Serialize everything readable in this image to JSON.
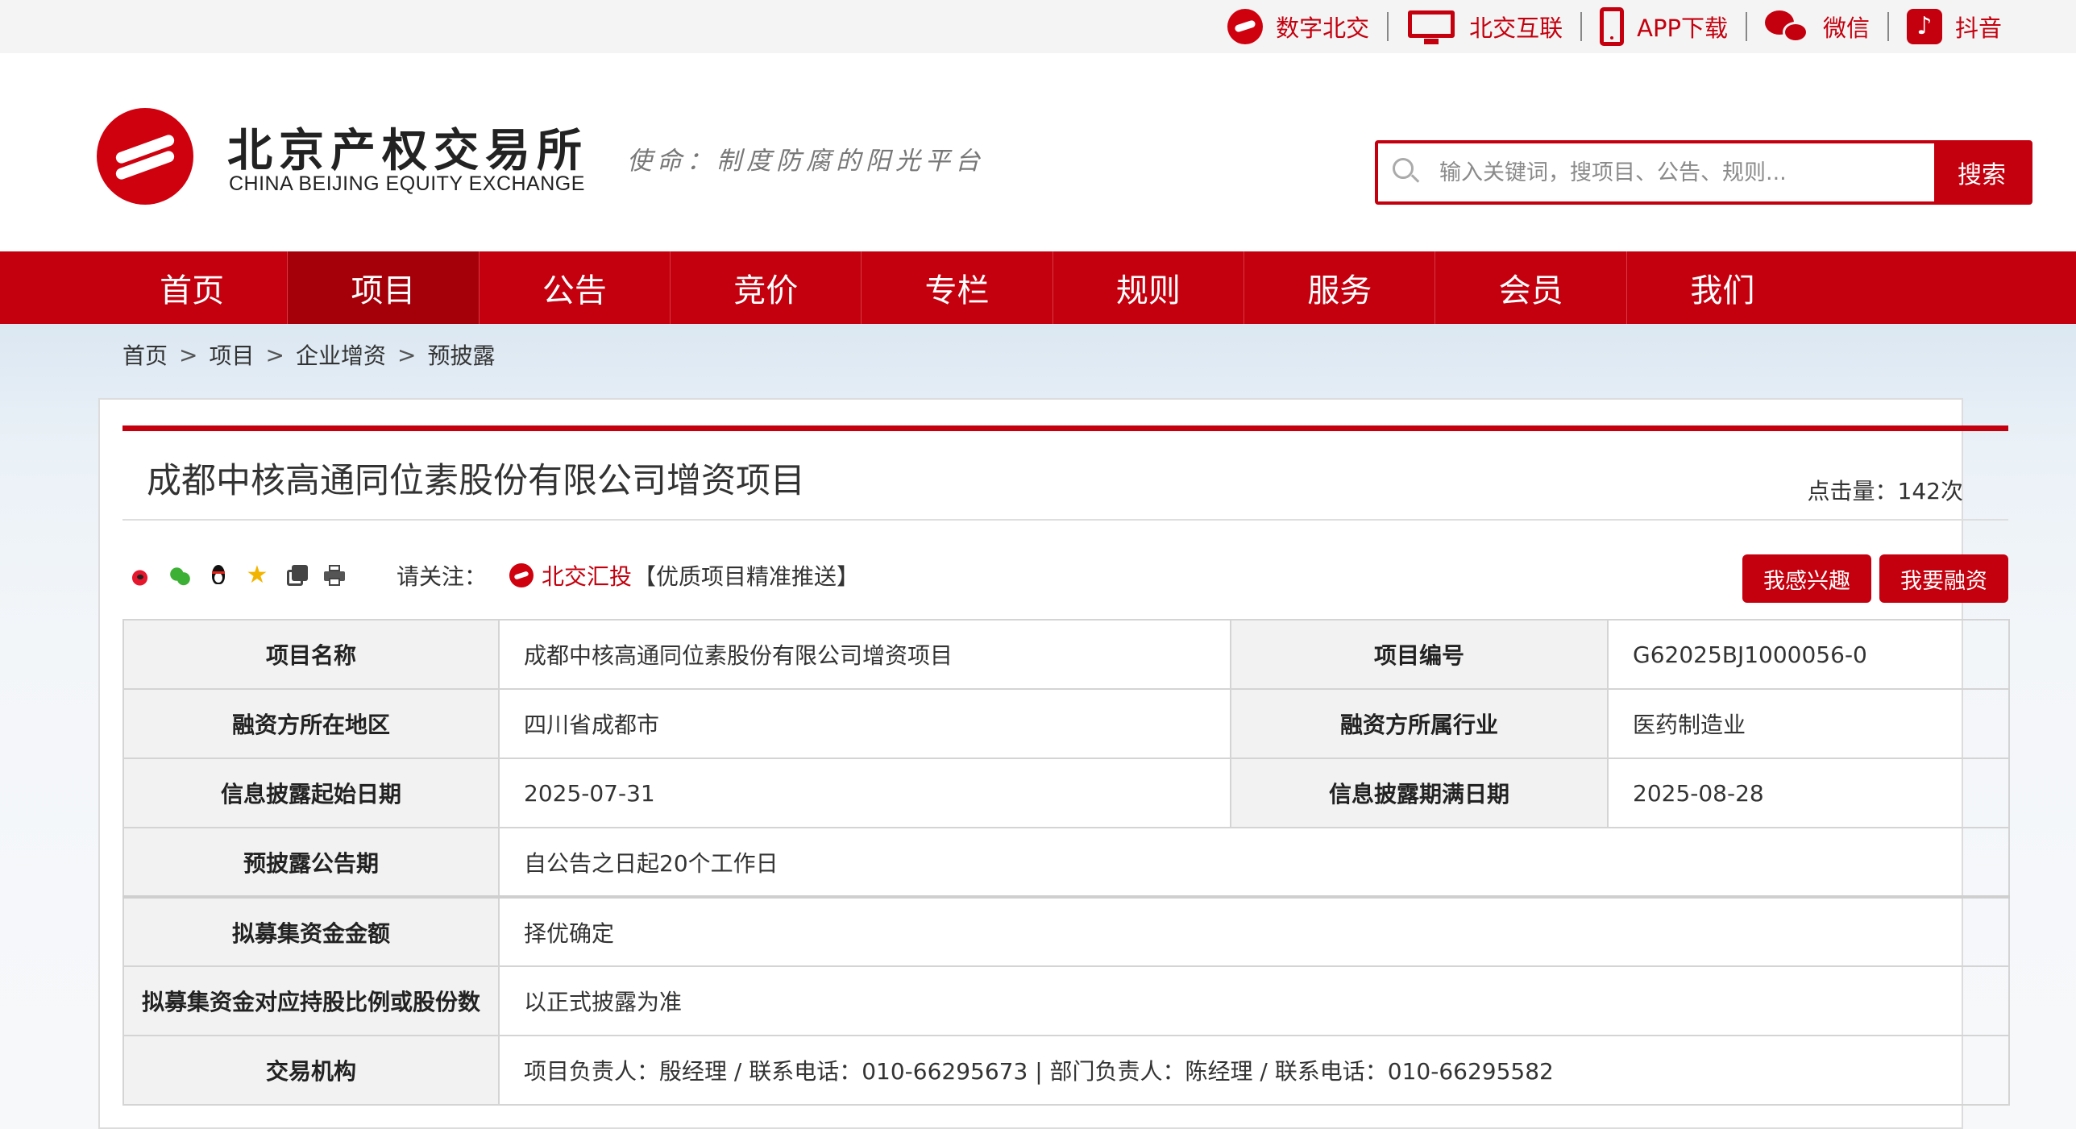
{
  "topbar": {
    "links": [
      {
        "label": "数字北交",
        "icon": "cbex-logo-icon"
      },
      {
        "label": "北交互联",
        "icon": "monitor-icon"
      },
      {
        "label": "APP下载",
        "icon": "mobile-phone-icon"
      },
      {
        "label": "微信",
        "icon": "wechat-icon"
      },
      {
        "label": "抖音",
        "icon": "douyin-icon"
      }
    ]
  },
  "header": {
    "logo_cn": "北京产权交易所",
    "logo_en": "CHINA BEIJING EQUITY EXCHANGE",
    "slogan": "使命：制度防腐的阳光平台",
    "search": {
      "placeholder": "输入关键词，搜项目、公告、规则...",
      "button_label": "搜索"
    }
  },
  "nav": {
    "items": [
      "首页",
      "项目",
      "公告",
      "竞价",
      "专栏",
      "规则",
      "服务",
      "会员",
      "我们"
    ],
    "active": "项目"
  },
  "breadcrumb": [
    "首页",
    "项目",
    "企业增资",
    "预披露"
  ],
  "breadcrumb_separator": ">",
  "project": {
    "title": "成都中核高通同位素股份有限公司增资项目",
    "clicks": "点击量：142次"
  },
  "share": {
    "icons": [
      "weibo-icon",
      "wechat-icon",
      "qq-icon",
      "favorite-star-icon",
      "copy-link-icon",
      "print-icon"
    ],
    "follow_label": "请关注：",
    "follow_link": "北交汇投",
    "follow_tag": "【优质项目精准推送】"
  },
  "actions": {
    "interest_label": "我感兴趣",
    "finance_label": "我要融资"
  },
  "info": {
    "project_name_label": "项目名称",
    "project_name": "成都中核高通同位素股份有限公司增资项目",
    "project_no_label": "项目编号",
    "project_no": "G62025BJ1000056-0",
    "region_label": "融资方所在地区",
    "region": "四川省成都市",
    "industry_label": "融资方所属行业",
    "industry": "医药制造业",
    "start_label": "信息披露起始日期",
    "start": "2025-07-31",
    "end_label": "信息披露期满日期",
    "end": "2025-08-28",
    "period_label": "预披露公告期",
    "period": "自公告之日起20个工作日",
    "amount_label": "拟募集资金金额",
    "amount": "择优确定",
    "ratio_label": "拟募集资金对应持股比例或股份数",
    "ratio": "以正式披露为准",
    "agency_label": "交易机构",
    "agency": "项目负责人：殷经理 / 联系电话：010-66295673 | 部门负责人：陈经理 / 联系电话：010-66295582"
  },
  "colors": {
    "brand_red": "#c4000e",
    "nav_active": "#a50009",
    "label_bg": "#f2f2f2"
  }
}
